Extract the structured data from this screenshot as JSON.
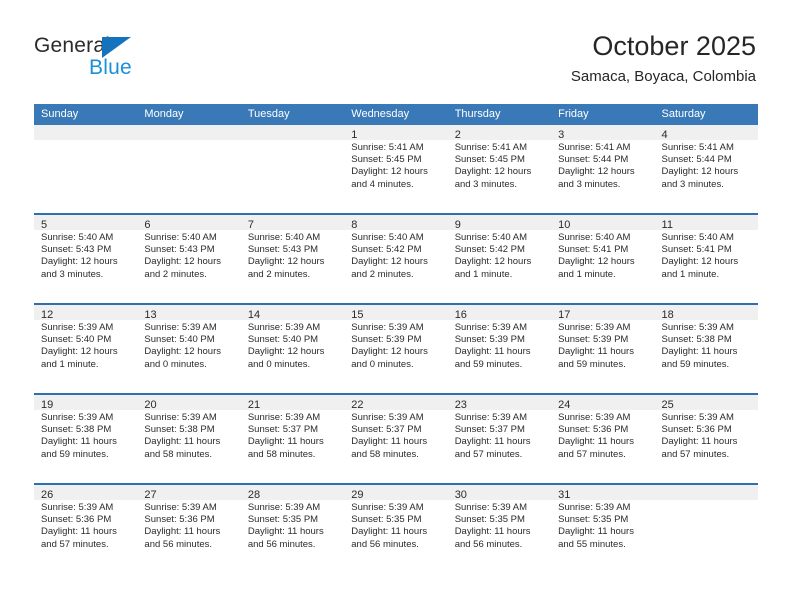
{
  "brand": {
    "name_part1": "General",
    "name_part2": "Blue",
    "colors": {
      "dark": "#2b2b2b",
      "blue": "#1d8fd8",
      "triangle": "#1572bd"
    }
  },
  "header": {
    "title": "October 2025",
    "subtitle": "Samaca, Boyaca, Colombia"
  },
  "theme": {
    "header_row_bg": "#3a79b8",
    "week_border": "#2e6fb0",
    "daynum_band_bg": "#f0f0f0",
    "text": "#2b2b2b"
  },
  "weekdays": [
    "Sunday",
    "Monday",
    "Tuesday",
    "Wednesday",
    "Thursday",
    "Friday",
    "Saturday"
  ],
  "weeks": [
    [
      {
        "day": "",
        "sunrise": "",
        "sunset": "",
        "daylight_line1": "",
        "daylight_line2": ""
      },
      {
        "day": "",
        "sunrise": "",
        "sunset": "",
        "daylight_line1": "",
        "daylight_line2": ""
      },
      {
        "day": "",
        "sunrise": "",
        "sunset": "",
        "daylight_line1": "",
        "daylight_line2": ""
      },
      {
        "day": "1",
        "sunrise": "Sunrise: 5:41 AM",
        "sunset": "Sunset: 5:45 PM",
        "daylight_line1": "Daylight: 12 hours",
        "daylight_line2": "and 4 minutes."
      },
      {
        "day": "2",
        "sunrise": "Sunrise: 5:41 AM",
        "sunset": "Sunset: 5:45 PM",
        "daylight_line1": "Daylight: 12 hours",
        "daylight_line2": "and 3 minutes."
      },
      {
        "day": "3",
        "sunrise": "Sunrise: 5:41 AM",
        "sunset": "Sunset: 5:44 PM",
        "daylight_line1": "Daylight: 12 hours",
        "daylight_line2": "and 3 minutes."
      },
      {
        "day": "4",
        "sunrise": "Sunrise: 5:41 AM",
        "sunset": "Sunset: 5:44 PM",
        "daylight_line1": "Daylight: 12 hours",
        "daylight_line2": "and 3 minutes."
      }
    ],
    [
      {
        "day": "5",
        "sunrise": "Sunrise: 5:40 AM",
        "sunset": "Sunset: 5:43 PM",
        "daylight_line1": "Daylight: 12 hours",
        "daylight_line2": "and 3 minutes."
      },
      {
        "day": "6",
        "sunrise": "Sunrise: 5:40 AM",
        "sunset": "Sunset: 5:43 PM",
        "daylight_line1": "Daylight: 12 hours",
        "daylight_line2": "and 2 minutes."
      },
      {
        "day": "7",
        "sunrise": "Sunrise: 5:40 AM",
        "sunset": "Sunset: 5:43 PM",
        "daylight_line1": "Daylight: 12 hours",
        "daylight_line2": "and 2 minutes."
      },
      {
        "day": "8",
        "sunrise": "Sunrise: 5:40 AM",
        "sunset": "Sunset: 5:42 PM",
        "daylight_line1": "Daylight: 12 hours",
        "daylight_line2": "and 2 minutes."
      },
      {
        "day": "9",
        "sunrise": "Sunrise: 5:40 AM",
        "sunset": "Sunset: 5:42 PM",
        "daylight_line1": "Daylight: 12 hours",
        "daylight_line2": "and 1 minute."
      },
      {
        "day": "10",
        "sunrise": "Sunrise: 5:40 AM",
        "sunset": "Sunset: 5:41 PM",
        "daylight_line1": "Daylight: 12 hours",
        "daylight_line2": "and 1 minute."
      },
      {
        "day": "11",
        "sunrise": "Sunrise: 5:40 AM",
        "sunset": "Sunset: 5:41 PM",
        "daylight_line1": "Daylight: 12 hours",
        "daylight_line2": "and 1 minute."
      }
    ],
    [
      {
        "day": "12",
        "sunrise": "Sunrise: 5:39 AM",
        "sunset": "Sunset: 5:40 PM",
        "daylight_line1": "Daylight: 12 hours",
        "daylight_line2": "and 1 minute."
      },
      {
        "day": "13",
        "sunrise": "Sunrise: 5:39 AM",
        "sunset": "Sunset: 5:40 PM",
        "daylight_line1": "Daylight: 12 hours",
        "daylight_line2": "and 0 minutes."
      },
      {
        "day": "14",
        "sunrise": "Sunrise: 5:39 AM",
        "sunset": "Sunset: 5:40 PM",
        "daylight_line1": "Daylight: 12 hours",
        "daylight_line2": "and 0 minutes."
      },
      {
        "day": "15",
        "sunrise": "Sunrise: 5:39 AM",
        "sunset": "Sunset: 5:39 PM",
        "daylight_line1": "Daylight: 12 hours",
        "daylight_line2": "and 0 minutes."
      },
      {
        "day": "16",
        "sunrise": "Sunrise: 5:39 AM",
        "sunset": "Sunset: 5:39 PM",
        "daylight_line1": "Daylight: 11 hours",
        "daylight_line2": "and 59 minutes."
      },
      {
        "day": "17",
        "sunrise": "Sunrise: 5:39 AM",
        "sunset": "Sunset: 5:39 PM",
        "daylight_line1": "Daylight: 11 hours",
        "daylight_line2": "and 59 minutes."
      },
      {
        "day": "18",
        "sunrise": "Sunrise: 5:39 AM",
        "sunset": "Sunset: 5:38 PM",
        "daylight_line1": "Daylight: 11 hours",
        "daylight_line2": "and 59 minutes."
      }
    ],
    [
      {
        "day": "19",
        "sunrise": "Sunrise: 5:39 AM",
        "sunset": "Sunset: 5:38 PM",
        "daylight_line1": "Daylight: 11 hours",
        "daylight_line2": "and 59 minutes."
      },
      {
        "day": "20",
        "sunrise": "Sunrise: 5:39 AM",
        "sunset": "Sunset: 5:38 PM",
        "daylight_line1": "Daylight: 11 hours",
        "daylight_line2": "and 58 minutes."
      },
      {
        "day": "21",
        "sunrise": "Sunrise: 5:39 AM",
        "sunset": "Sunset: 5:37 PM",
        "daylight_line1": "Daylight: 11 hours",
        "daylight_line2": "and 58 minutes."
      },
      {
        "day": "22",
        "sunrise": "Sunrise: 5:39 AM",
        "sunset": "Sunset: 5:37 PM",
        "daylight_line1": "Daylight: 11 hours",
        "daylight_line2": "and 58 minutes."
      },
      {
        "day": "23",
        "sunrise": "Sunrise: 5:39 AM",
        "sunset": "Sunset: 5:37 PM",
        "daylight_line1": "Daylight: 11 hours",
        "daylight_line2": "and 57 minutes."
      },
      {
        "day": "24",
        "sunrise": "Sunrise: 5:39 AM",
        "sunset": "Sunset: 5:36 PM",
        "daylight_line1": "Daylight: 11 hours",
        "daylight_line2": "and 57 minutes."
      },
      {
        "day": "25",
        "sunrise": "Sunrise: 5:39 AM",
        "sunset": "Sunset: 5:36 PM",
        "daylight_line1": "Daylight: 11 hours",
        "daylight_line2": "and 57 minutes."
      }
    ],
    [
      {
        "day": "26",
        "sunrise": "Sunrise: 5:39 AM",
        "sunset": "Sunset: 5:36 PM",
        "daylight_line1": "Daylight: 11 hours",
        "daylight_line2": "and 57 minutes."
      },
      {
        "day": "27",
        "sunrise": "Sunrise: 5:39 AM",
        "sunset": "Sunset: 5:36 PM",
        "daylight_line1": "Daylight: 11 hours",
        "daylight_line2": "and 56 minutes."
      },
      {
        "day": "28",
        "sunrise": "Sunrise: 5:39 AM",
        "sunset": "Sunset: 5:35 PM",
        "daylight_line1": "Daylight: 11 hours",
        "daylight_line2": "and 56 minutes."
      },
      {
        "day": "29",
        "sunrise": "Sunrise: 5:39 AM",
        "sunset": "Sunset: 5:35 PM",
        "daylight_line1": "Daylight: 11 hours",
        "daylight_line2": "and 56 minutes."
      },
      {
        "day": "30",
        "sunrise": "Sunrise: 5:39 AM",
        "sunset": "Sunset: 5:35 PM",
        "daylight_line1": "Daylight: 11 hours",
        "daylight_line2": "and 56 minutes."
      },
      {
        "day": "31",
        "sunrise": "Sunrise: 5:39 AM",
        "sunset": "Sunset: 5:35 PM",
        "daylight_line1": "Daylight: 11 hours",
        "daylight_line2": "and 55 minutes."
      },
      {
        "day": "",
        "sunrise": "",
        "sunset": "",
        "daylight_line1": "",
        "daylight_line2": ""
      }
    ]
  ]
}
